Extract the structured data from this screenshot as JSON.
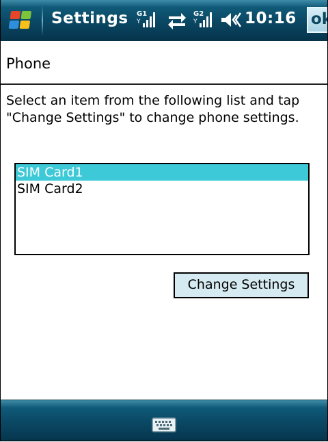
{
  "titlebar": {
    "title": "Settings",
    "time": "10:16",
    "ok_label": "ok",
    "icons": [
      "windows-start-icon",
      "signal-sim1-icon",
      "data-connection-icon",
      "signal-sim2-icon",
      "volume-icon"
    ]
  },
  "header": {
    "title": "Phone"
  },
  "instructions": "Select an item from the following list and tap \"Change Settings\" to change phone settings.",
  "sim_list": {
    "items": [
      {
        "label": "SIM Card1",
        "selected": true
      },
      {
        "label": "SIM Card2",
        "selected": false
      }
    ],
    "selected_color": "#3ec9d8"
  },
  "change_settings_label": "Change Settings",
  "menubar": {
    "icons": [
      "keyboard-icon"
    ]
  },
  "colors": {
    "bar_dark": "#0a4763",
    "bar_light": "#3f8ca8",
    "button_face": "#d6ebf1"
  }
}
